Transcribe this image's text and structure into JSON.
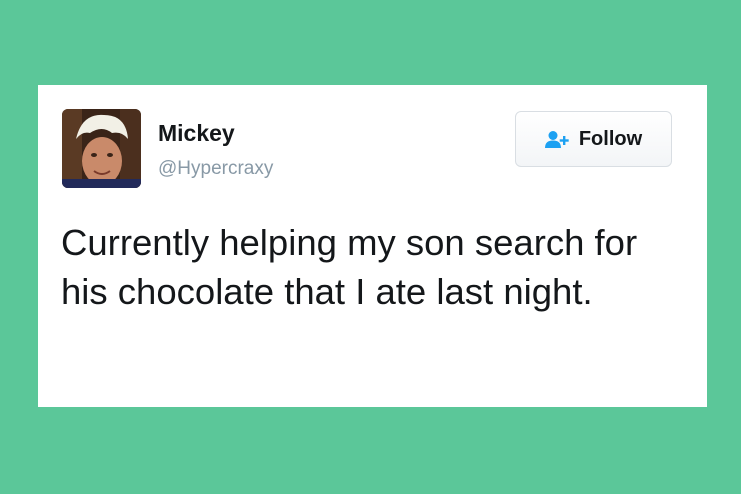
{
  "tweet": {
    "author": {
      "name": "Mickey",
      "handle": "@Hypercraxy",
      "avatar_icon": "profile-photo"
    },
    "follow_button": {
      "label": "Follow",
      "icon": "add-person-icon"
    },
    "text": "Currently helping my son search for his chocolate that I ate last night."
  },
  "colors": {
    "background": "#5bc799",
    "card": "#ffffff",
    "name_text": "#14171a",
    "handle_text": "#8899a6",
    "follow_icon": "#1da1f2"
  }
}
